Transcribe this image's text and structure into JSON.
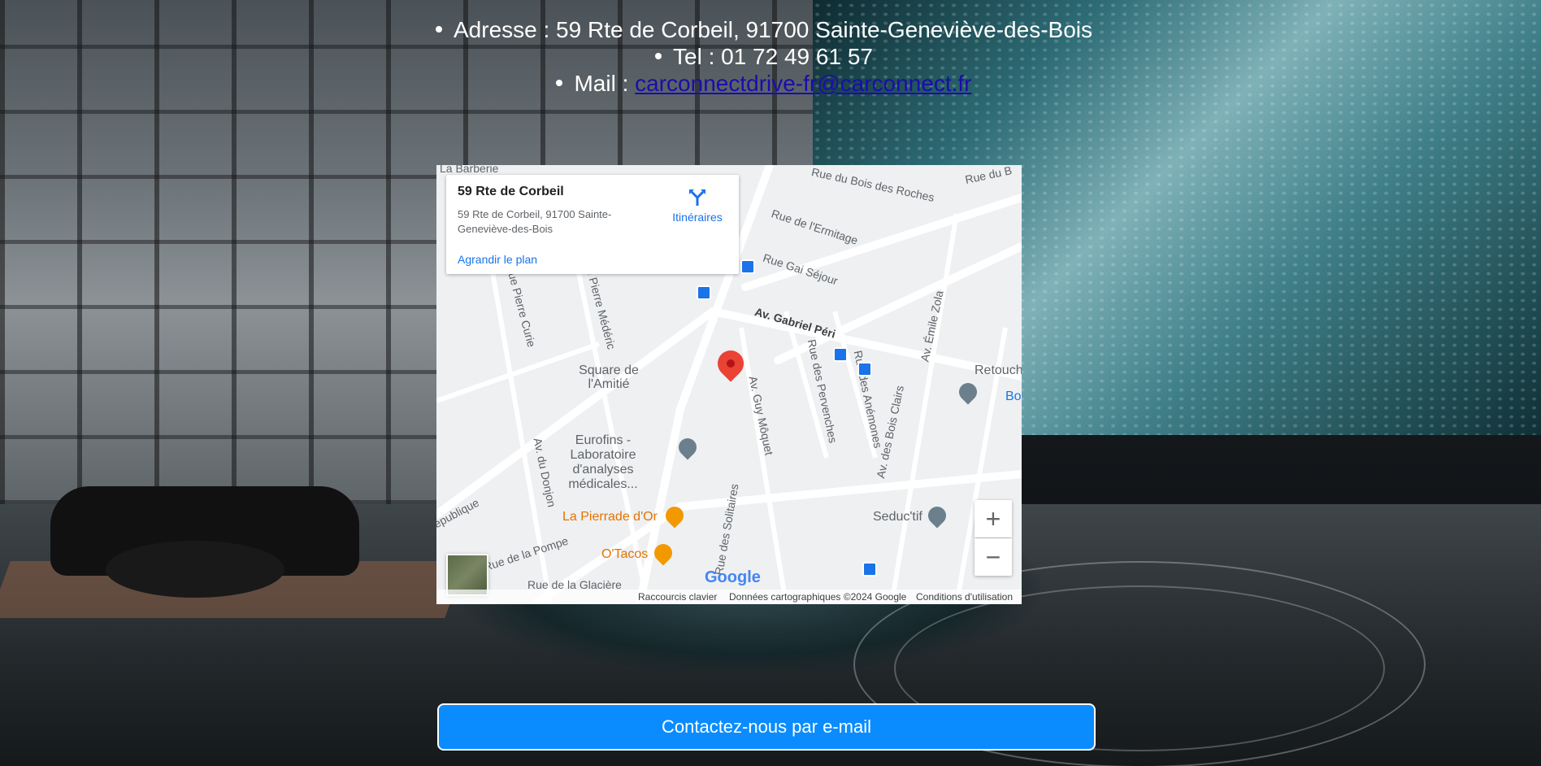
{
  "contact": {
    "address": "Adresse : 59 Rte de Corbeil, 91700 Sainte-Geneviève-des-Bois",
    "phone": "Tel : 01 72 49 61 57",
    "mail_prefix": "Mail : ",
    "mail_link": "carconnectdrive-fr@carconnect.fr"
  },
  "map": {
    "card": {
      "title": "59 Rte de Corbeil",
      "address": "59 Rte de Corbeil, 91700 Sainte-Geneviève-des-Bois",
      "directions_label": "Itinéraires",
      "enlarge_label": "Agrandir le plan"
    },
    "street_labels": {
      "barberie": "La Barberie",
      "bois_roches": "Rue du Bois des Roches",
      "ermitage": "Rue de l'Ermitage",
      "gai_sejour": "Rue Gai Séjour",
      "gabriel_peri": "Av. Gabriel Péri",
      "pierre_curie": "Rue Pierre Curie",
      "pierre_mederic": "Rue Pierre Médéric",
      "guy_moquet": "Av. Guy Môquet",
      "pervenches": "Rue des Pervenches",
      "anemones": "Rue des Anémones",
      "emile_zola": "Av. Émile Zola",
      "bois_clairs": "Av. des Bois Clairs",
      "republique": "épublique",
      "donjon": "Av. du Donjon",
      "pompe": "Rue de la Pompe",
      "glaciere": "Rue de la Glacière",
      "solitaires": "Rue des Solitaires",
      "du_bo": "Rue du B"
    },
    "pois": {
      "square": "Square de l'Amitié",
      "eurofins": "Eurofins - Laboratoire d'analyses médicales...",
      "pierrade": "La Pierrade d'Or",
      "otacos": "O'Tacos",
      "retoucherie": "Retoucherie",
      "seductif": "Seduc'tif",
      "bo": "Bo"
    },
    "zoom_in": "+",
    "zoom_out": "−",
    "logo": "Google",
    "footer": {
      "shortcuts": "Raccourcis clavier",
      "data": "Données cartographiques ©2024 Google",
      "terms": "Conditions d'utilisation"
    }
  },
  "cta": {
    "label": "Contactez-nous par e-mail"
  },
  "colors": {
    "cta": "#0a8cff",
    "link": "#1a0dab",
    "map_link": "#1a73e8",
    "marker": "#ea4335"
  }
}
